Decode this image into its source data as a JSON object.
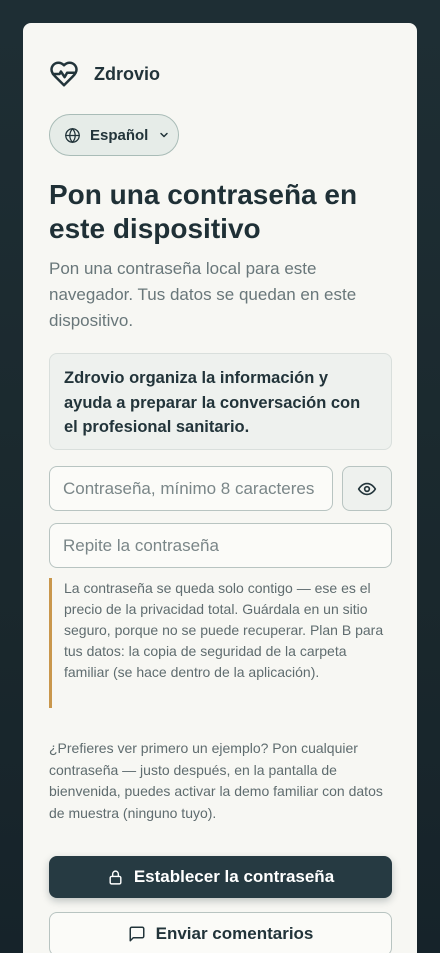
{
  "app": {
    "name": "Zdrovio"
  },
  "language": {
    "selected": "Español"
  },
  "page": {
    "title": "Pon una contraseña en este dispositivo",
    "subtitle": "Pon una contraseña local para este navegador. Tus datos se quedan en este dispositivo."
  },
  "info": {
    "text": "Zdrovio organiza la información y ayuda a preparar la conversación con el profesional sanitario."
  },
  "form": {
    "password_placeholder": "Contraseña, mínimo 8 caracteres",
    "password_value": "",
    "repeat_placeholder": "Repite la contraseña",
    "repeat_value": ""
  },
  "note": {
    "text": "La contraseña se queda solo contigo — ese es el precio de la privacidad total. Guárdala en un sitio seguro, porque no se puede recuperar. Plan B para tus datos: la copia de seguridad de la carpeta familiar (se hace dentro de la aplicación)."
  },
  "hint": {
    "text": "¿Prefieres ver primero un ejemplo? Pon cualquier contraseña — justo después, en la pantalla de bienvenida, puedes activar la demo familiar con datos de muestra (ninguno tuyo)."
  },
  "buttons": {
    "set_password": "Establecer la contraseña",
    "feedback": "Enviar comentarios"
  },
  "icons": {
    "brand": "heart-pulse-icon",
    "language": "globe-icon",
    "dropdown": "chevron-down-icon",
    "toggle_visibility": "eye-icon",
    "set_password": "lock-icon",
    "feedback": "message-square-icon"
  },
  "colors": {
    "background": "#1e2e34",
    "card": "#f7f7f3",
    "primary_button": "#263a42",
    "note_accent": "#c9974c",
    "heading": "#1f3036"
  }
}
